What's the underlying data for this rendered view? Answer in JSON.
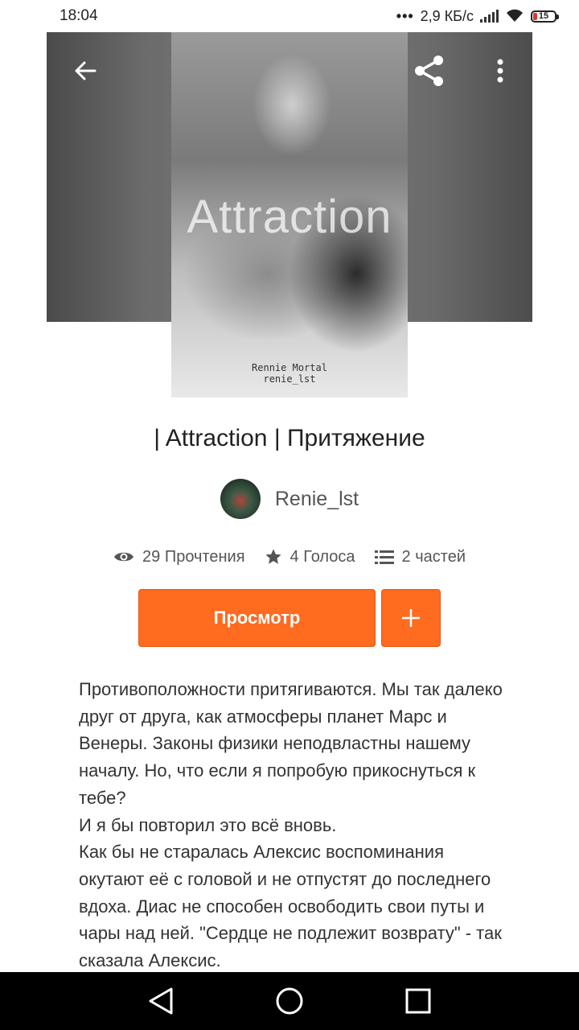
{
  "status_bar": {
    "time": "18:04",
    "network_speed": "2,9 КБ/с",
    "battery": "15",
    "icons": [
      "signal-icon",
      "wifi-icon",
      "battery-icon"
    ]
  },
  "header": {
    "icons": [
      "back-arrow-icon",
      "share-icon",
      "more-vertical-icon"
    ]
  },
  "cover": {
    "title": "Attraction",
    "author": "Rennie Mortal",
    "username": "renie_lst"
  },
  "story": {
    "title": "| Attraction | Притяжение",
    "author": "Renie_lst",
    "stats": {
      "reads": "29 Прочтения",
      "votes": "4 Голоса",
      "parts": "2 частей"
    },
    "read_button": "Просмотр",
    "add_button": "+",
    "description": [
      "Противоположности притягиваются. Мы так далеко друг от друга, как атмосферы планет Марс и Венеры. Законы физики неподвластны нашему началу. Но, что если я попробую прикоснуться к тебе?",
      "И я бы повторил это всё вновь.",
      "Как бы не старалась Алексис воспоминания окутают её с головой и не отпустят до последнего вдоха. Диас не способен освободить свои путы и чары над ней. \"Сердце не подлежит возврату\" - так сказала Алексис."
    ]
  },
  "nav_bar": {
    "icons": [
      "back-triangle-icon",
      "home-circle-icon",
      "recents-square-icon"
    ]
  },
  "colors": {
    "accent": "#ff6b1f",
    "nav_bar": "#000000",
    "battery_low": "#e0342f"
  }
}
